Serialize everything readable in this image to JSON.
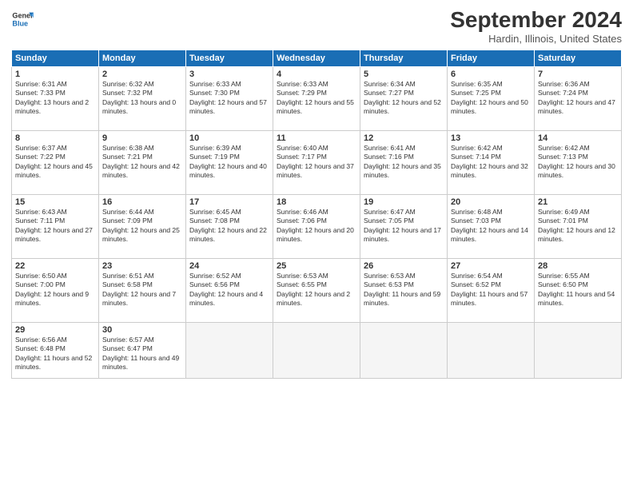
{
  "logo": {
    "line1": "General",
    "line2": "Blue"
  },
  "title": "September 2024",
  "subtitle": "Hardin, Illinois, United States",
  "days_of_week": [
    "Sunday",
    "Monday",
    "Tuesday",
    "Wednesday",
    "Thursday",
    "Friday",
    "Saturday"
  ],
  "weeks": [
    [
      {
        "day": 1,
        "sunrise": "6:31 AM",
        "sunset": "7:33 PM",
        "daylight": "13 hours and 2 minutes."
      },
      {
        "day": 2,
        "sunrise": "6:32 AM",
        "sunset": "7:32 PM",
        "daylight": "13 hours and 0 minutes."
      },
      {
        "day": 3,
        "sunrise": "6:33 AM",
        "sunset": "7:30 PM",
        "daylight": "12 hours and 57 minutes."
      },
      {
        "day": 4,
        "sunrise": "6:33 AM",
        "sunset": "7:29 PM",
        "daylight": "12 hours and 55 minutes."
      },
      {
        "day": 5,
        "sunrise": "6:34 AM",
        "sunset": "7:27 PM",
        "daylight": "12 hours and 52 minutes."
      },
      {
        "day": 6,
        "sunrise": "6:35 AM",
        "sunset": "7:25 PM",
        "daylight": "12 hours and 50 minutes."
      },
      {
        "day": 7,
        "sunrise": "6:36 AM",
        "sunset": "7:24 PM",
        "daylight": "12 hours and 47 minutes."
      }
    ],
    [
      {
        "day": 8,
        "sunrise": "6:37 AM",
        "sunset": "7:22 PM",
        "daylight": "12 hours and 45 minutes."
      },
      {
        "day": 9,
        "sunrise": "6:38 AM",
        "sunset": "7:21 PM",
        "daylight": "12 hours and 42 minutes."
      },
      {
        "day": 10,
        "sunrise": "6:39 AM",
        "sunset": "7:19 PM",
        "daylight": "12 hours and 40 minutes."
      },
      {
        "day": 11,
        "sunrise": "6:40 AM",
        "sunset": "7:17 PM",
        "daylight": "12 hours and 37 minutes."
      },
      {
        "day": 12,
        "sunrise": "6:41 AM",
        "sunset": "7:16 PM",
        "daylight": "12 hours and 35 minutes."
      },
      {
        "day": 13,
        "sunrise": "6:42 AM",
        "sunset": "7:14 PM",
        "daylight": "12 hours and 32 minutes."
      },
      {
        "day": 14,
        "sunrise": "6:42 AM",
        "sunset": "7:13 PM",
        "daylight": "12 hours and 30 minutes."
      }
    ],
    [
      {
        "day": 15,
        "sunrise": "6:43 AM",
        "sunset": "7:11 PM",
        "daylight": "12 hours and 27 minutes."
      },
      {
        "day": 16,
        "sunrise": "6:44 AM",
        "sunset": "7:09 PM",
        "daylight": "12 hours and 25 minutes."
      },
      {
        "day": 17,
        "sunrise": "6:45 AM",
        "sunset": "7:08 PM",
        "daylight": "12 hours and 22 minutes."
      },
      {
        "day": 18,
        "sunrise": "6:46 AM",
        "sunset": "7:06 PM",
        "daylight": "12 hours and 20 minutes."
      },
      {
        "day": 19,
        "sunrise": "6:47 AM",
        "sunset": "7:05 PM",
        "daylight": "12 hours and 17 minutes."
      },
      {
        "day": 20,
        "sunrise": "6:48 AM",
        "sunset": "7:03 PM",
        "daylight": "12 hours and 14 minutes."
      },
      {
        "day": 21,
        "sunrise": "6:49 AM",
        "sunset": "7:01 PM",
        "daylight": "12 hours and 12 minutes."
      }
    ],
    [
      {
        "day": 22,
        "sunrise": "6:50 AM",
        "sunset": "7:00 PM",
        "daylight": "12 hours and 9 minutes."
      },
      {
        "day": 23,
        "sunrise": "6:51 AM",
        "sunset": "6:58 PM",
        "daylight": "12 hours and 7 minutes."
      },
      {
        "day": 24,
        "sunrise": "6:52 AM",
        "sunset": "6:56 PM",
        "daylight": "12 hours and 4 minutes."
      },
      {
        "day": 25,
        "sunrise": "6:53 AM",
        "sunset": "6:55 PM",
        "daylight": "12 hours and 2 minutes."
      },
      {
        "day": 26,
        "sunrise": "6:53 AM",
        "sunset": "6:53 PM",
        "daylight": "11 hours and 59 minutes."
      },
      {
        "day": 27,
        "sunrise": "6:54 AM",
        "sunset": "6:52 PM",
        "daylight": "11 hours and 57 minutes."
      },
      {
        "day": 28,
        "sunrise": "6:55 AM",
        "sunset": "6:50 PM",
        "daylight": "11 hours and 54 minutes."
      }
    ],
    [
      {
        "day": 29,
        "sunrise": "6:56 AM",
        "sunset": "6:48 PM",
        "daylight": "11 hours and 52 minutes."
      },
      {
        "day": 30,
        "sunrise": "6:57 AM",
        "sunset": "6:47 PM",
        "daylight": "11 hours and 49 minutes."
      },
      null,
      null,
      null,
      null,
      null
    ]
  ]
}
